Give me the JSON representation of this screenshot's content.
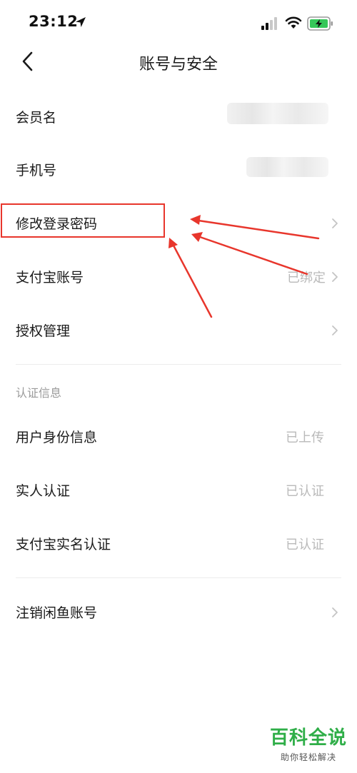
{
  "status_bar": {
    "time": "23:12"
  },
  "nav": {
    "title": "账号与安全"
  },
  "account_rows": [
    {
      "label": "会员名",
      "value": ""
    },
    {
      "label": "手机号",
      "value": ""
    },
    {
      "label": "修改登录密码",
      "value": ""
    },
    {
      "label": "支付宝账号",
      "value": "已绑定"
    },
    {
      "label": "授权管理",
      "value": ""
    }
  ],
  "certification": {
    "section_title": "认证信息",
    "rows": [
      {
        "label": "用户身份信息",
        "value": "已上传"
      },
      {
        "label": "实人认证",
        "value": "已认证"
      },
      {
        "label": "支付宝实名认证",
        "value": "已认证"
      }
    ]
  },
  "footer_rows": [
    {
      "label": "注销闲鱼账号"
    }
  ],
  "annotation_color": "#e8362c",
  "watermark": {
    "title": "百科全说",
    "subtitle": "助你轻松解决"
  }
}
